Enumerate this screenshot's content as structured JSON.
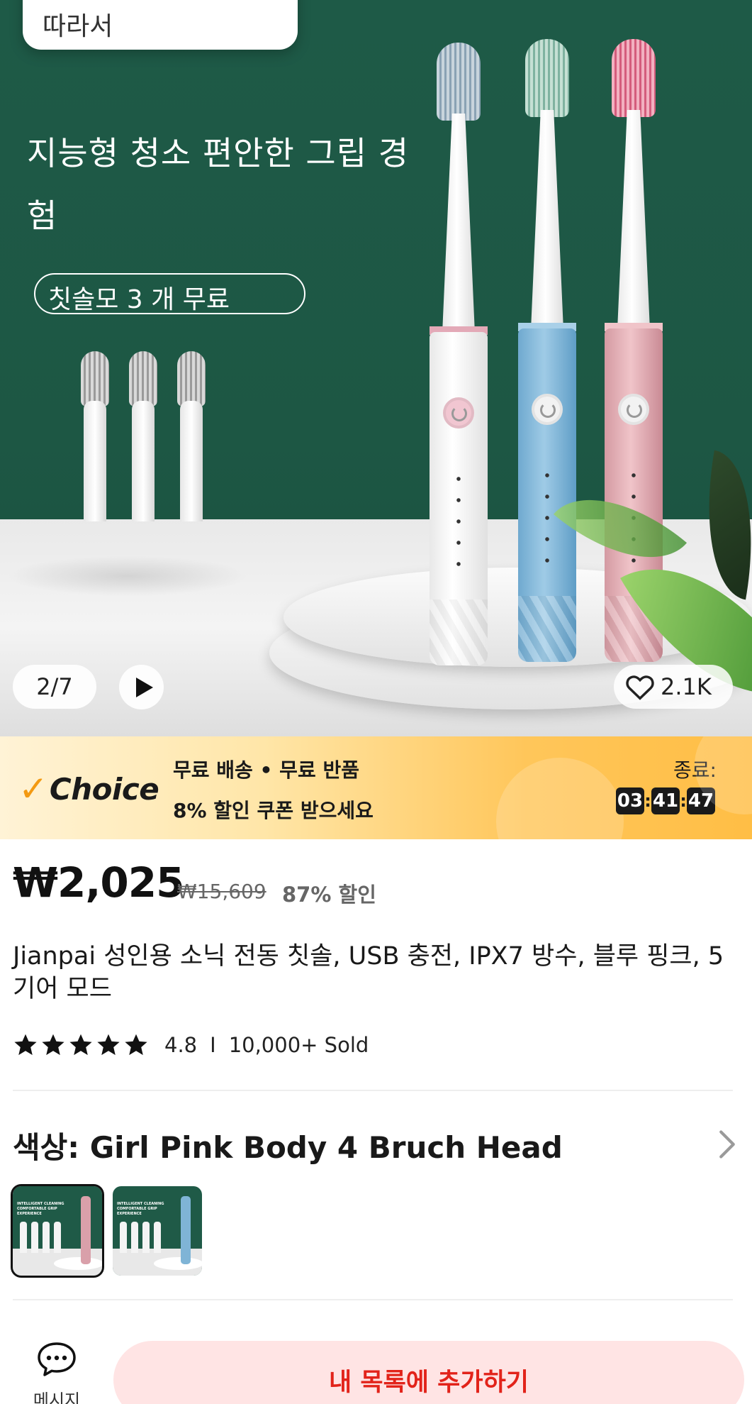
{
  "hero": {
    "tag_text": "따라서",
    "headline": "지능형 청소 편안한 그립 경험",
    "pill_text": "칫솔모 3 개 무료",
    "counter": "2/7",
    "likes": "2.1K"
  },
  "choice_banner": {
    "logo_text": "Choice",
    "line1": "무료 배송 • 무료 반품",
    "line2": "8% 할인 쿠폰 받으세요",
    "end_label": "종료:",
    "timer": {
      "hours": "03",
      "minutes": "41",
      "seconds": "47"
    }
  },
  "price": {
    "current": "₩2,025",
    "original": "₩15,609",
    "discount": "87% 할인"
  },
  "product": {
    "title": "Jianpai 성인용 소닉 전동 칫솔, USB 충전, IPX7 방수, 블루 핑크, 5 기어 모드",
    "rating": "4.8",
    "rating_fraction": 0.96,
    "separator": "I",
    "sold": "10,000+ Sold"
  },
  "color_selector": {
    "label": "색상: ",
    "value": "Girl Pink Body  4 Bruch Head",
    "variants": [
      {
        "text": "INTELLIGENT CLEANING COMFORTABLE GRIP EXPERIENCE",
        "accent": "#d9a0aa",
        "selected": true
      },
      {
        "text": "INTELLIGENT CLEANING COMFORTABLE GRIP EXPERIENCE",
        "accent": "#7fb4d6",
        "selected": false
      }
    ]
  },
  "bottom_bar": {
    "message_label": "메시지",
    "wishlist_label": "내 목록에 추가하기"
  },
  "colors": {
    "hero_green": "#1e5a47",
    "accent_red": "#e2231a",
    "wishlist_bg": "#ffe4e4",
    "choice_orange": "#f39a12"
  }
}
